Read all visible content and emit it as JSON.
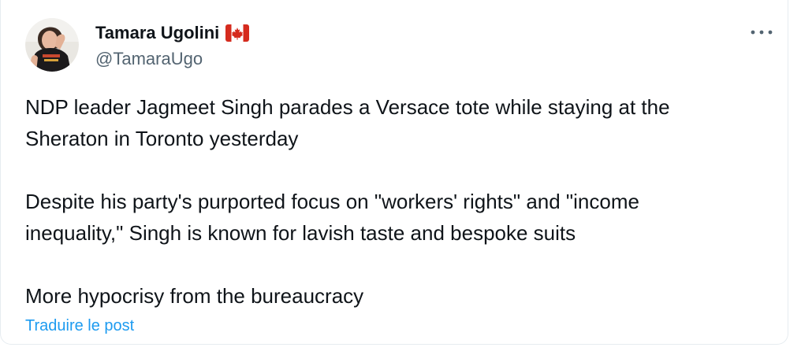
{
  "author": {
    "display_name": "Tamara Ugolini",
    "flag_emoji": "🇨🇦",
    "handle": "@TamaraUgo"
  },
  "menu": {
    "icon": "more-horizontal-icon",
    "label": "•••"
  },
  "tweet": {
    "paragraphs": [
      "NDP leader Jagmeet Singh parades a Versace tote while staying at the\nSheraton in Toronto yesterday",
      "Despite his party's purported focus on \"workers' rights\" and \"income\ninequality,\" Singh is known for lavish taste and bespoke suits",
      "More hypocrisy from the bureaucracy"
    ],
    "translate_link": "Traduire le post"
  },
  "colors": {
    "link": "#1d9bf0",
    "text": "#0f1419",
    "secondary_text": "#536471",
    "flag_red": "#d52b1e"
  }
}
